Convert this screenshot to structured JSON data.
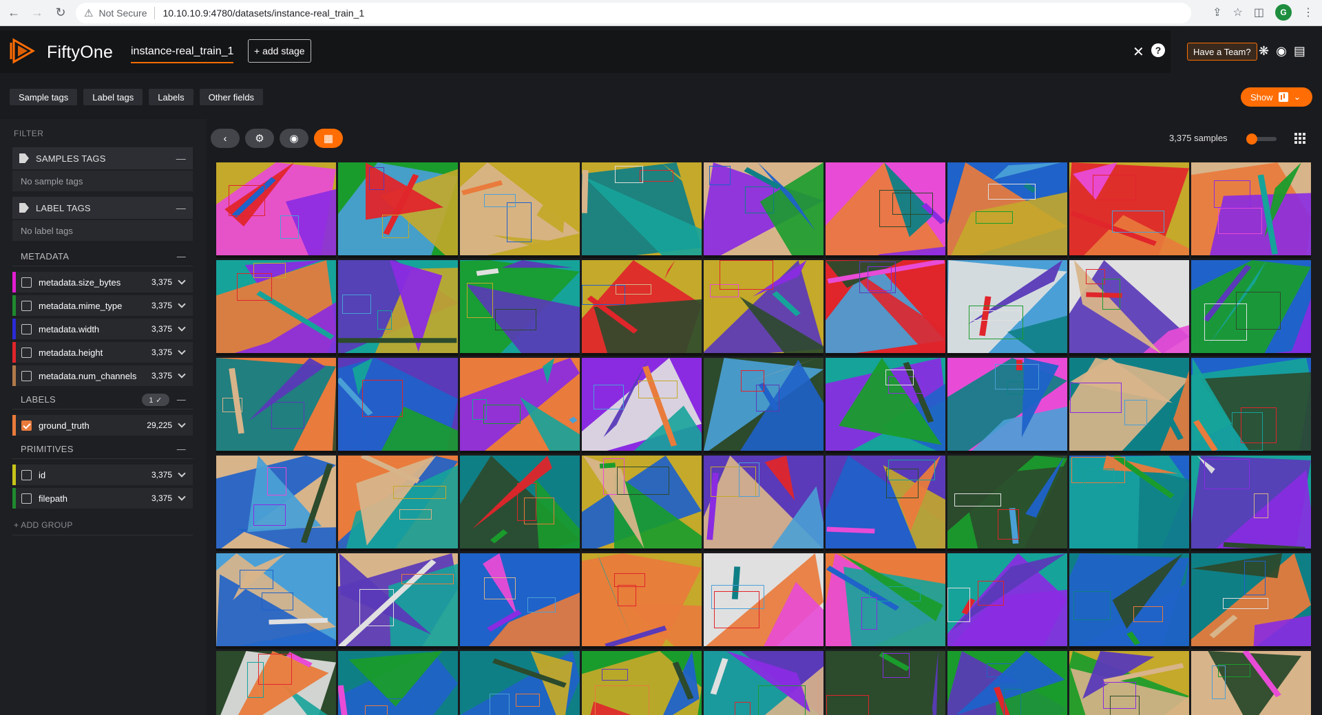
{
  "browser": {
    "security_label": "Not Secure",
    "url": "10.10.10.9:4780/datasets/instance-real_train_1",
    "avatar_letter": "G"
  },
  "header": {
    "brand": "FiftyOne",
    "dataset_name": "instance-real_train_1",
    "add_stage_label": "+ add stage",
    "team_button_label": "Have a Team?"
  },
  "field_tabs": [
    {
      "label": "Sample tags"
    },
    {
      "label": "Label tags"
    },
    {
      "label": "Labels"
    },
    {
      "label": "Other fields"
    }
  ],
  "show_button_label": "Show",
  "sidebar": {
    "filter_label": "FILTER",
    "samples_tags": {
      "title": "SAMPLES TAGS",
      "empty": "No sample tags"
    },
    "label_tags": {
      "title": "LABEL TAGS",
      "empty": "No label tags"
    },
    "metadata": {
      "title": "METADATA",
      "fields": [
        {
          "name": "metadata.size_bytes",
          "count": "3,375",
          "color": "#e11ed1"
        },
        {
          "name": "metadata.mime_type",
          "count": "3,375",
          "color": "#1f8a2e"
        },
        {
          "name": "metadata.width",
          "count": "3,375",
          "color": "#2b2bd6"
        },
        {
          "name": "metadata.height",
          "count": "3,375",
          "color": "#e0252b"
        },
        {
          "name": "metadata.num_channels",
          "count": "3,375",
          "color": "#b07a4a"
        }
      ]
    },
    "labels": {
      "title": "LABELS",
      "badge": "1 ✓",
      "fields": [
        {
          "name": "ground_truth",
          "count": "29,225",
          "color": "#e97b3c",
          "checked": true
        }
      ]
    },
    "primitives": {
      "title": "PRIMITIVES",
      "fields": [
        {
          "name": "id",
          "count": "3,375",
          "color": "#c7c41a"
        },
        {
          "name": "filepath",
          "count": "3,375",
          "color": "#1f8a2e"
        }
      ]
    },
    "add_group_label": "+ ADD GROUP"
  },
  "grid": {
    "samples_count": "3,375 samples"
  },
  "mask_colors": [
    "#1f62c9",
    "#8a2be2",
    "#1a9c2c",
    "#e0252b",
    "#e0e0e0",
    "#e97b3c",
    "#c4a92a",
    "#e84bd6",
    "#16a39a",
    "#5a3ab8",
    "#2c4a2c",
    "#d8b48a",
    "#0f7f86",
    "#4aa0d6"
  ]
}
